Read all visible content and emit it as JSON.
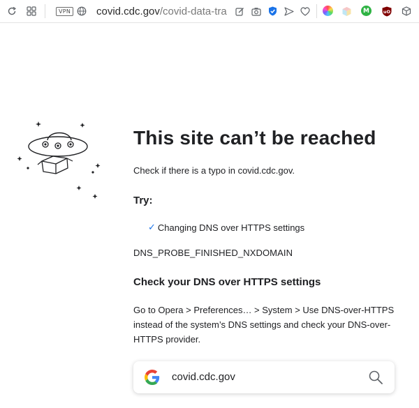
{
  "toolbar": {
    "icons": [
      "reload-icon",
      "tab-grid-icon",
      "vpn-badge",
      "globe-icon"
    ],
    "vpn_label": "VPN",
    "url_host": "covid.cdc.gov",
    "url_path": "/covid-data-track",
    "url_icons": [
      "edit-icon",
      "camera-icon",
      "shield-check-icon",
      "send-icon",
      "heart-icon"
    ],
    "extensions": [
      "color-wheel-extension-icon",
      "cube-extension-icon",
      "m-extension-icon",
      "ublock-extension-icon",
      "package-icon"
    ],
    "colors": {
      "shield": "#1a73e8",
      "m_ext": "#2fb344",
      "ublock": "#800000"
    }
  },
  "error": {
    "title": "This site can’t be reached",
    "typo_text": "Check if there is a typo in covid.cdc.gov.",
    "try_label": "Try:",
    "suggestion": "Changing DNS over HTTPS settings",
    "error_code": "DNS_PROBE_FINISHED_NXDOMAIN",
    "dns_heading": "Check your DNS over HTTPS settings",
    "dns_body": "Go to Opera > Preferences… > System > Use DNS-over-HTTPS instead of the system’s DNS settings and check your DNS-over-HTTPS provider."
  },
  "search": {
    "query": "covid.cdc.gov",
    "icons": [
      "google-logo-icon",
      "search-icon"
    ]
  },
  "illustration": "ufo-illustration-icon"
}
